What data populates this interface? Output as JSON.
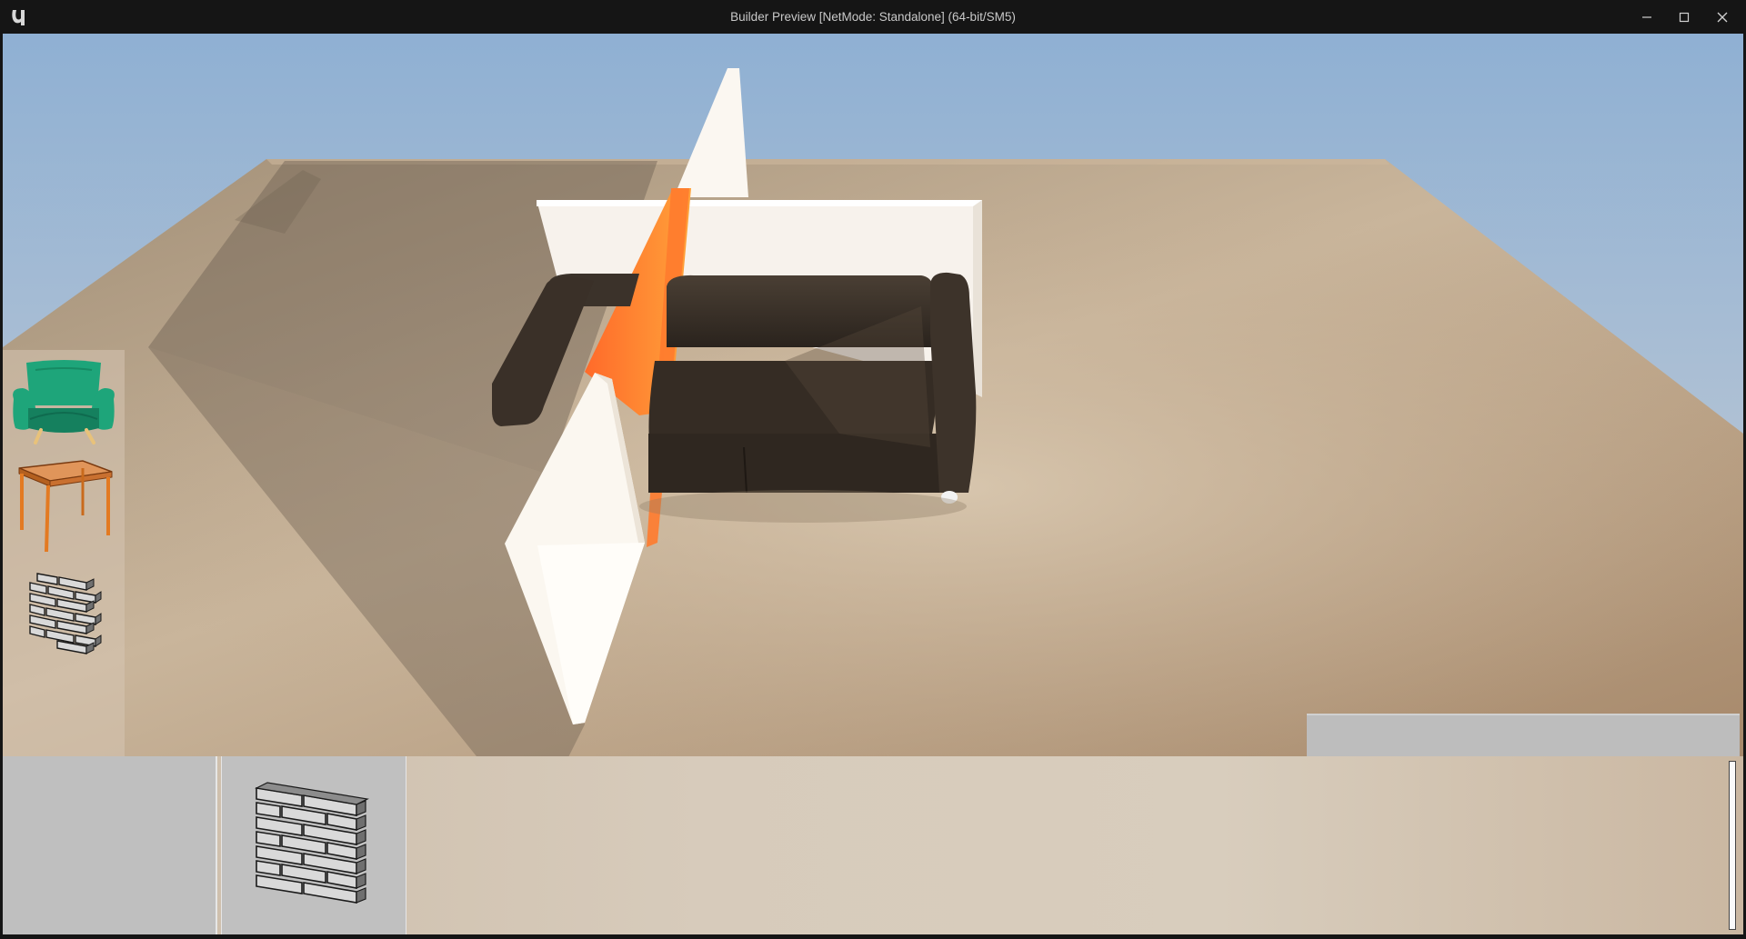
{
  "window": {
    "title": "Builder Preview [NetMode: Standalone]  (64-bit/SM5)",
    "controls": [
      "minimize-icon",
      "maximize-icon",
      "close-icon"
    ]
  },
  "catalog": {
    "items": [
      {
        "name": "armchair",
        "icon": "armchair-icon"
      },
      {
        "name": "table",
        "icon": "table-icon"
      },
      {
        "name": "wall",
        "icon": "brick-wall-icon"
      }
    ]
  },
  "bottom_bar": {
    "slots": [
      {
        "icon": "empty"
      },
      {
        "icon": "brick-wall-icon"
      }
    ]
  },
  "colors": {
    "sky": "#a9bdd2",
    "floor": "#bba58b",
    "wall": "#fbf6ef",
    "sofa": "#3a3129",
    "armchair": "#1fa37a",
    "table": "#d98237",
    "highlight": "#ff8a2a"
  }
}
